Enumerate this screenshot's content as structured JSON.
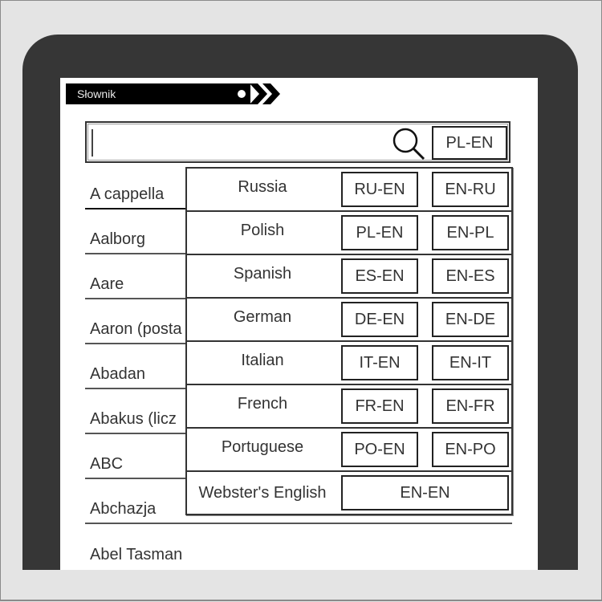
{
  "app": {
    "title": "Słownik"
  },
  "search": {
    "value": "",
    "placeholder": "",
    "icon": "search-icon",
    "current_direction": "PL-EN"
  },
  "words": [
    "A cappella",
    "Aalborg",
    "Aare",
    "Aaron (posta",
    "Abadan",
    "Abakus (licz",
    "ABC",
    "Abchazja",
    "Abel Tasman"
  ],
  "dropdown": {
    "languages": [
      {
        "name": "Russia",
        "to_en": "RU-EN",
        "from_en": "EN-RU"
      },
      {
        "name": "Polish",
        "to_en": "PL-EN",
        "from_en": "EN-PL"
      },
      {
        "name": "Spanish",
        "to_en": "ES-EN",
        "from_en": "EN-ES"
      },
      {
        "name": "German",
        "to_en": "DE-EN",
        "from_en": "EN-DE"
      },
      {
        "name": "Italian",
        "to_en": "IT-EN",
        "from_en": "EN-IT"
      },
      {
        "name": "French",
        "to_en": "FR-EN",
        "from_en": "EN-FR"
      },
      {
        "name": "Portuguese",
        "to_en": "PO-EN",
        "from_en": "EN-PO"
      }
    ],
    "websters": {
      "name": "Webster's English",
      "code": "EN-EN"
    }
  }
}
